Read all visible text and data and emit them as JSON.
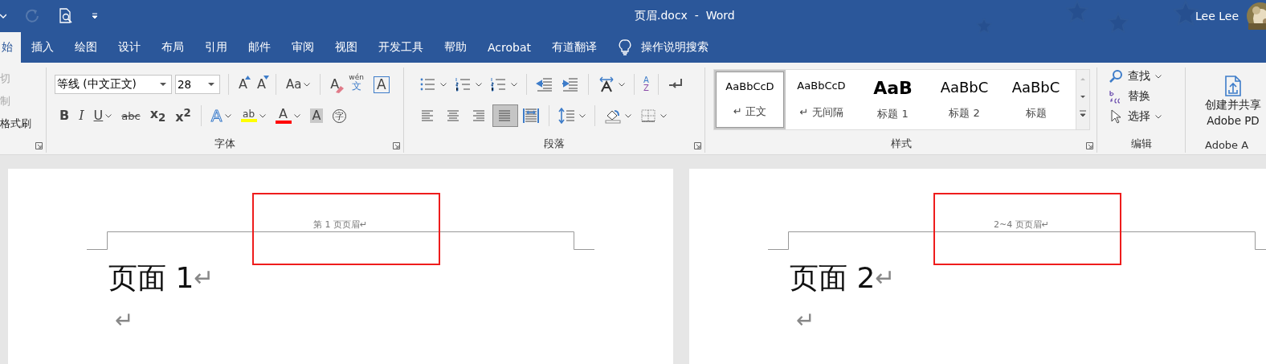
{
  "title_bar": {
    "title": "页眉.docx  -  Word",
    "user": "Lee Lee",
    "quick_access": [
      {
        "kind": "caret",
        "disabled": false
      },
      {
        "kind": "redo",
        "disabled": true
      },
      {
        "kind": "preview",
        "disabled": false
      },
      {
        "kind": "customize",
        "disabled": false
      }
    ]
  },
  "tabs": [
    {
      "label": "始",
      "selected": true
    },
    {
      "label": "插入",
      "selected": false
    },
    {
      "label": "绘图",
      "selected": false
    },
    {
      "label": "设计",
      "selected": false
    },
    {
      "label": "布局",
      "selected": false
    },
    {
      "label": "引用",
      "selected": false
    },
    {
      "label": "邮件",
      "selected": false
    },
    {
      "label": "审阅",
      "selected": false
    },
    {
      "label": "视图",
      "selected": false
    },
    {
      "label": "开发工具",
      "selected": false
    },
    {
      "label": "帮助",
      "selected": false
    },
    {
      "label": "Acrobat",
      "selected": false
    },
    {
      "label": "有道翻译",
      "selected": false
    }
  ],
  "tell_me": "操作说明搜索",
  "ribbon": {
    "clipboard": {
      "items": [
        {
          "label": "切",
          "disabled": true
        },
        {
          "label": "制",
          "disabled": true
        },
        {
          "label": "格式刷",
          "disabled": false
        }
      ]
    },
    "font": {
      "label": "字体",
      "font_name": "等线 (中文正文)",
      "font_size": "28",
      "row1": [
        [
          {
            "kind": "grow",
            "glyph": "A",
            "dropdown": false
          },
          {
            "kind": "shrink",
            "glyph": "A",
            "dropdown": false
          }
        ],
        [
          {
            "kind": "case",
            "glyph": "Aa",
            "dropdown": true
          }
        ],
        [
          {
            "kind": "clear",
            "glyph": "A",
            "dropdown": false
          },
          {
            "kind": "phonetic",
            "glyph": "文",
            "ruby": "wén",
            "dropdown": false
          },
          {
            "kind": "border",
            "glyph": "A",
            "dropdown": false
          }
        ]
      ],
      "row2": [
        [
          {
            "kind": "bold",
            "glyph": "B",
            "dropdown": false
          },
          {
            "kind": "italic",
            "glyph": "I",
            "dropdown": false
          },
          {
            "kind": "underline",
            "glyph": "U",
            "dropdown": true
          },
          {
            "kind": "strike",
            "glyph": "abc",
            "dropdown": false
          },
          {
            "kind": "sub",
            "glyph": "x$_{2}$",
            "dropdown": false
          },
          {
            "kind": "sup",
            "glyph": "x$^{2}$",
            "dropdown": false
          }
        ],
        [
          {
            "kind": "effects",
            "glyph": "A",
            "dropdown": true
          },
          {
            "kind": "highlight",
            "glyph": "ab",
            "dropdown": true
          },
          {
            "kind": "color",
            "glyph": "A",
            "dropdown": true
          },
          {
            "kind": "shade",
            "glyph": "A",
            "dropdown": false
          },
          {
            "kind": "enclose",
            "glyph": "字",
            "dropdown": false
          }
        ]
      ]
    },
    "paragraph": {
      "label": "段落",
      "row1": [
        [
          {
            "kind": "bullets",
            "dropdown": true
          },
          {
            "kind": "numbering",
            "dropdown": true
          },
          {
            "kind": "multilevel",
            "dropdown": true
          }
        ],
        [
          {
            "kind": "outdent",
            "dropdown": false
          },
          {
            "kind": "indent",
            "dropdown": false
          }
        ],
        [
          {
            "kind": "asian",
            "dropdown": true
          }
        ],
        [
          {
            "kind": "sort",
            "glyph_top": "A",
            "glyph_bottom": "Z",
            "dropdown": false
          }
        ],
        [
          {
            "kind": "marks",
            "dropdown": false
          }
        ]
      ],
      "row2": [
        [
          {
            "kind": "align-left",
            "selected": false,
            "dropdown": false
          },
          {
            "kind": "align-center",
            "selected": false,
            "dropdown": false
          },
          {
            "kind": "align-right",
            "selected": false,
            "dropdown": false
          },
          {
            "kind": "justify",
            "selected": true,
            "dropdown": false
          },
          {
            "kind": "distribute",
            "selected": false,
            "dropdown": false
          }
        ],
        [
          {
            "kind": "spacing",
            "dropdown": true
          }
        ],
        [
          {
            "kind": "shading",
            "dropdown": true
          },
          {
            "kind": "borders",
            "dropdown": true
          }
        ]
      ]
    },
    "styles": {
      "label": "样式",
      "items": [
        {
          "kind": "normal",
          "preview": "AaBbCcD",
          "name": "↵ 正文",
          "selected": true
        },
        {
          "kind": "normal",
          "preview": "AaBbCcD",
          "name": "↵ 无间隔",
          "selected": false
        },
        {
          "kind": "heading1",
          "preview": "AaB",
          "name": "标题 1",
          "selected": false
        },
        {
          "kind": "heading2",
          "preview": "AaBbC",
          "name": "标题 2",
          "selected": false
        },
        {
          "kind": "heading2",
          "preview": "AaBbC",
          "name": "标题",
          "selected": false
        }
      ]
    },
    "editing": {
      "label": "编辑",
      "items": [
        {
          "kind": "find",
          "label": "查找",
          "dropdown": true
        },
        {
          "kind": "replace",
          "label": "替换",
          "dropdown": false
        },
        {
          "kind": "select",
          "label": "选择",
          "dropdown": true
        }
      ]
    },
    "adobe": {
      "label": "Adobe A",
      "button_lines": [
        "创建并共享",
        "Adobe PD"
      ]
    }
  },
  "pages": [
    {
      "header": "第 1 页页眉↵",
      "heading": "页面 1",
      "mark": "↵",
      "empty_mark": "↵",
      "outlined": true
    },
    {
      "header": "2~4 页页眉↵",
      "heading": "页面 2",
      "mark": "↵",
      "empty_mark": "↵",
      "outlined": true
    }
  ]
}
